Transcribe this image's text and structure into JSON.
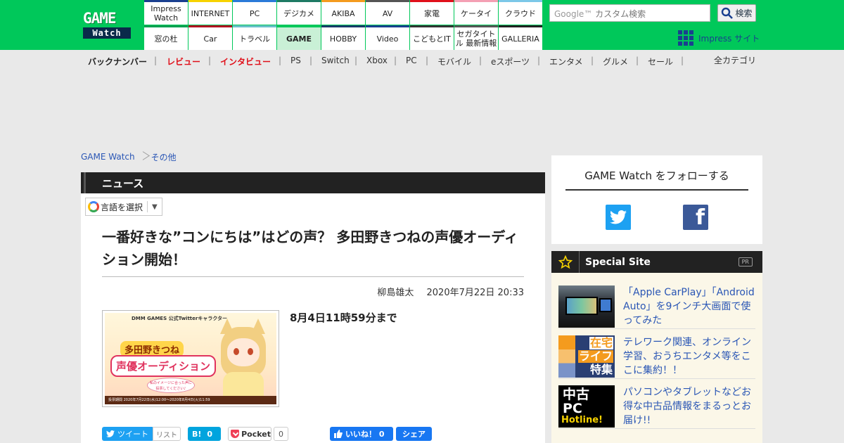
{
  "logo": {
    "line1": "GAME",
    "line2": "Watch"
  },
  "sites": {
    "row1": [
      {
        "label": "Impress Watch",
        "color": "#1a3f8f"
      },
      {
        "label": "INTERNET",
        "color": "#f7d200"
      },
      {
        "label": "PC",
        "color": "#2a7ad8"
      },
      {
        "label": "デジカメ",
        "color": "#1e7a64"
      },
      {
        "label": "AKIBA",
        "color": "#f49b1e"
      },
      {
        "label": "AV",
        "color": "#555555"
      },
      {
        "label": "家電",
        "color": "#e0101a"
      },
      {
        "label": "ケータイ",
        "color": "#f4a0b4"
      },
      {
        "label": "クラウド",
        "color": "#7cc8e8"
      }
    ],
    "row2": [
      {
        "label": "窓の杜",
        "color": "#00a050"
      },
      {
        "label": "Car",
        "color": "#b01020"
      },
      {
        "label": "トラベル",
        "color": "#68c0c8"
      },
      {
        "label": "GAME",
        "color": "#00c85a",
        "active": true
      },
      {
        "label": "HOBBY",
        "color": "#1a3a6a"
      },
      {
        "label": "Video",
        "color": "#1a3f8f"
      },
      {
        "label": "こどもとIT",
        "color": "#333333"
      },
      {
        "label": "セガタイトル 最新情報",
        "color": "#555555"
      },
      {
        "label": "GALLERIA",
        "color": "#222222"
      }
    ]
  },
  "search": {
    "placeholder": "カスタム検索",
    "google_label": "Google™",
    "button_label": "検索"
  },
  "impress_site_label": "Impress サイト",
  "categories": [
    {
      "label": "バックナンバー",
      "style": "bold"
    },
    {
      "label": "レビュー",
      "style": "red"
    },
    {
      "label": "インタビュー",
      "style": "red"
    },
    {
      "label": "PS",
      "style": ""
    },
    {
      "label": "Switch",
      "style": ""
    },
    {
      "label": "Xbox",
      "style": ""
    },
    {
      "label": "PC",
      "style": ""
    },
    {
      "label": "モバイル",
      "style": ""
    },
    {
      "label": "eスポーツ",
      "style": ""
    },
    {
      "label": "エンタメ",
      "style": ""
    },
    {
      "label": "グルメ",
      "style": ""
    },
    {
      "label": "セール",
      "style": ""
    }
  ],
  "all_categories_label": "全カテゴリ",
  "breadcrumb": {
    "home": "GAME Watch",
    "current": "その他"
  },
  "section_label": "ニュース",
  "language_select_label": "言語を選択",
  "article": {
    "title": "一番好きな”コンにちは”はどの声？ 多田野きつねの声優オーディション開始！",
    "author": "柳島雄太",
    "date": "2020年7月22日 20:33",
    "lede": "8月4日11時59分まで",
    "image": {
      "top_text": "DMM GAMES 公式Twitterキャラクター",
      "name_text": "多田野きつね",
      "audition_text": "声優オーディション",
      "bubble_text": "私のイメージに合った声に 投票してください♪",
      "period_text": "投票期間 2020年7月22日(水)12:00〜2020年8月4日(火)11:59"
    }
  },
  "share": {
    "tweet_label": "ツイート",
    "list_label": "リスト",
    "hatena_label": "B!",
    "hatena_count": "0",
    "pocket_label": "Pocket",
    "pocket_count": "0",
    "like_label": "いいね！ 0",
    "fb_share_label": "シェア"
  },
  "follow": {
    "title": "GAME Watch をフォローする"
  },
  "special": {
    "title": "Special Site",
    "pr_label": "PR",
    "items": [
      {
        "text": "「Apple CarPlay」「Android Auto」を9インチ大画面で使ってみた"
      },
      {
        "text": "テレワーク関連、オンライン学習、おうちエンタメ等をここに集約！！",
        "img_l1": "在宅",
        "img_l2": "ライフ",
        "img_l3": "特集"
      },
      {
        "text": "パソコンやタブレットなどお得な中古品情報をまるっとお届け!!",
        "img_l1": "中古",
        "img_l2": "PC",
        "img_l3": "Hotline!"
      }
    ]
  }
}
